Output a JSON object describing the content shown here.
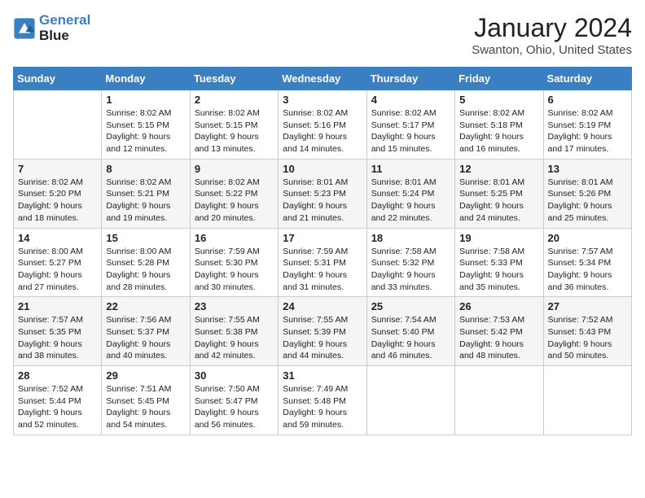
{
  "header": {
    "logo_line1": "General",
    "logo_line2": "Blue",
    "month": "January 2024",
    "location": "Swanton, Ohio, United States"
  },
  "days_of_week": [
    "Sunday",
    "Monday",
    "Tuesday",
    "Wednesday",
    "Thursday",
    "Friday",
    "Saturday"
  ],
  "weeks": [
    [
      {
        "day": "",
        "info": ""
      },
      {
        "day": "1",
        "info": "Sunrise: 8:02 AM\nSunset: 5:15 PM\nDaylight: 9 hours\nand 12 minutes."
      },
      {
        "day": "2",
        "info": "Sunrise: 8:02 AM\nSunset: 5:15 PM\nDaylight: 9 hours\nand 13 minutes."
      },
      {
        "day": "3",
        "info": "Sunrise: 8:02 AM\nSunset: 5:16 PM\nDaylight: 9 hours\nand 14 minutes."
      },
      {
        "day": "4",
        "info": "Sunrise: 8:02 AM\nSunset: 5:17 PM\nDaylight: 9 hours\nand 15 minutes."
      },
      {
        "day": "5",
        "info": "Sunrise: 8:02 AM\nSunset: 5:18 PM\nDaylight: 9 hours\nand 16 minutes."
      },
      {
        "day": "6",
        "info": "Sunrise: 8:02 AM\nSunset: 5:19 PM\nDaylight: 9 hours\nand 17 minutes."
      }
    ],
    [
      {
        "day": "7",
        "info": "Sunrise: 8:02 AM\nSunset: 5:20 PM\nDaylight: 9 hours\nand 18 minutes."
      },
      {
        "day": "8",
        "info": "Sunrise: 8:02 AM\nSunset: 5:21 PM\nDaylight: 9 hours\nand 19 minutes."
      },
      {
        "day": "9",
        "info": "Sunrise: 8:02 AM\nSunset: 5:22 PM\nDaylight: 9 hours\nand 20 minutes."
      },
      {
        "day": "10",
        "info": "Sunrise: 8:01 AM\nSunset: 5:23 PM\nDaylight: 9 hours\nand 21 minutes."
      },
      {
        "day": "11",
        "info": "Sunrise: 8:01 AM\nSunset: 5:24 PM\nDaylight: 9 hours\nand 22 minutes."
      },
      {
        "day": "12",
        "info": "Sunrise: 8:01 AM\nSunset: 5:25 PM\nDaylight: 9 hours\nand 24 minutes."
      },
      {
        "day": "13",
        "info": "Sunrise: 8:01 AM\nSunset: 5:26 PM\nDaylight: 9 hours\nand 25 minutes."
      }
    ],
    [
      {
        "day": "14",
        "info": "Sunrise: 8:00 AM\nSunset: 5:27 PM\nDaylight: 9 hours\nand 27 minutes."
      },
      {
        "day": "15",
        "info": "Sunrise: 8:00 AM\nSunset: 5:28 PM\nDaylight: 9 hours\nand 28 minutes."
      },
      {
        "day": "16",
        "info": "Sunrise: 7:59 AM\nSunset: 5:30 PM\nDaylight: 9 hours\nand 30 minutes."
      },
      {
        "day": "17",
        "info": "Sunrise: 7:59 AM\nSunset: 5:31 PM\nDaylight: 9 hours\nand 31 minutes."
      },
      {
        "day": "18",
        "info": "Sunrise: 7:58 AM\nSunset: 5:32 PM\nDaylight: 9 hours\nand 33 minutes."
      },
      {
        "day": "19",
        "info": "Sunrise: 7:58 AM\nSunset: 5:33 PM\nDaylight: 9 hours\nand 35 minutes."
      },
      {
        "day": "20",
        "info": "Sunrise: 7:57 AM\nSunset: 5:34 PM\nDaylight: 9 hours\nand 36 minutes."
      }
    ],
    [
      {
        "day": "21",
        "info": "Sunrise: 7:57 AM\nSunset: 5:35 PM\nDaylight: 9 hours\nand 38 minutes."
      },
      {
        "day": "22",
        "info": "Sunrise: 7:56 AM\nSunset: 5:37 PM\nDaylight: 9 hours\nand 40 minutes."
      },
      {
        "day": "23",
        "info": "Sunrise: 7:55 AM\nSunset: 5:38 PM\nDaylight: 9 hours\nand 42 minutes."
      },
      {
        "day": "24",
        "info": "Sunrise: 7:55 AM\nSunset: 5:39 PM\nDaylight: 9 hours\nand 44 minutes."
      },
      {
        "day": "25",
        "info": "Sunrise: 7:54 AM\nSunset: 5:40 PM\nDaylight: 9 hours\nand 46 minutes."
      },
      {
        "day": "26",
        "info": "Sunrise: 7:53 AM\nSunset: 5:42 PM\nDaylight: 9 hours\nand 48 minutes."
      },
      {
        "day": "27",
        "info": "Sunrise: 7:52 AM\nSunset: 5:43 PM\nDaylight: 9 hours\nand 50 minutes."
      }
    ],
    [
      {
        "day": "28",
        "info": "Sunrise: 7:52 AM\nSunset: 5:44 PM\nDaylight: 9 hours\nand 52 minutes."
      },
      {
        "day": "29",
        "info": "Sunrise: 7:51 AM\nSunset: 5:45 PM\nDaylight: 9 hours\nand 54 minutes."
      },
      {
        "day": "30",
        "info": "Sunrise: 7:50 AM\nSunset: 5:47 PM\nDaylight: 9 hours\nand 56 minutes."
      },
      {
        "day": "31",
        "info": "Sunrise: 7:49 AM\nSunset: 5:48 PM\nDaylight: 9 hours\nand 59 minutes."
      },
      {
        "day": "",
        "info": ""
      },
      {
        "day": "",
        "info": ""
      },
      {
        "day": "",
        "info": ""
      }
    ]
  ]
}
